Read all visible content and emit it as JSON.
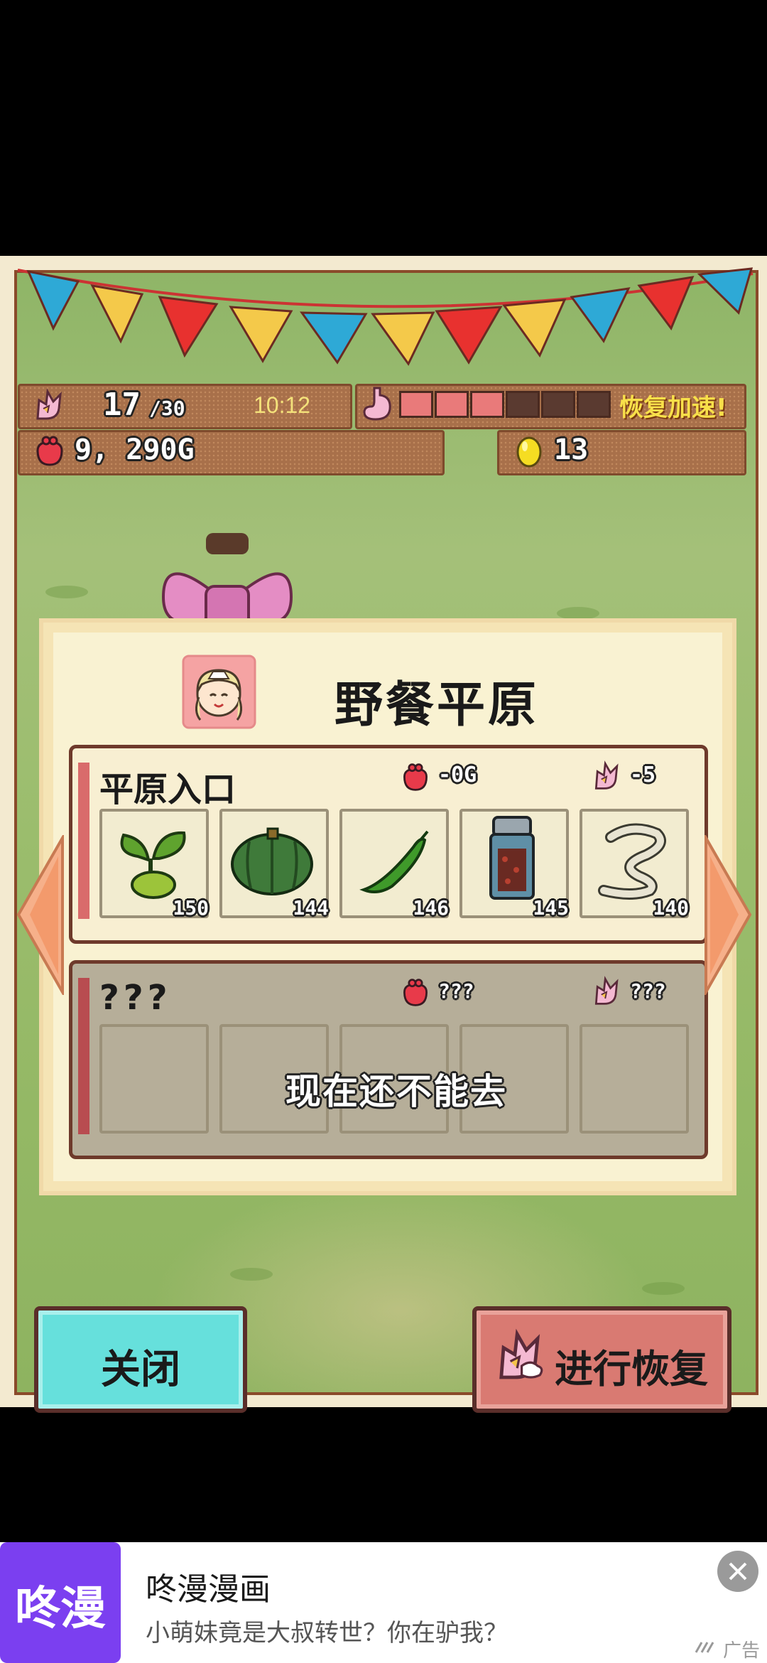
{
  "stats": {
    "stamina_current": "17",
    "stamina_max": "/30",
    "timer": "10:12",
    "recover_label": "恢复加速!",
    "gauge_filled": 3,
    "gauge_total": 6,
    "gold": "9, 290G",
    "eggs": "13"
  },
  "dialog": {
    "title": "野餐平原",
    "area1": {
      "name": "平原入口",
      "cost_gold": "-0G",
      "cost_stamina": "-5",
      "items": [
        {
          "icon": "sprout-icon",
          "count": "150"
        },
        {
          "icon": "pumpkin-icon",
          "count": "144"
        },
        {
          "icon": "green-bean-icon",
          "count": "146"
        },
        {
          "icon": "spice-jar-icon",
          "count": "145"
        },
        {
          "icon": "noodle-icon",
          "count": "140"
        }
      ]
    },
    "area2": {
      "name": "???",
      "cost_gold": "???",
      "cost_stamina": "???",
      "locked_text": "现在还不能去"
    }
  },
  "buttons": {
    "close": "关闭",
    "recover": "进行恢复"
  },
  "ad": {
    "app_icon_text": "咚漫",
    "title": "咚漫漫画",
    "subtitle": "小萌妹竟是大叔转世？你在驴我？",
    "tag": "广告"
  },
  "colors": {
    "close_button": "#66e0dc",
    "recover_button": "#d97a72",
    "ad_icon": "#7b3ff0"
  }
}
